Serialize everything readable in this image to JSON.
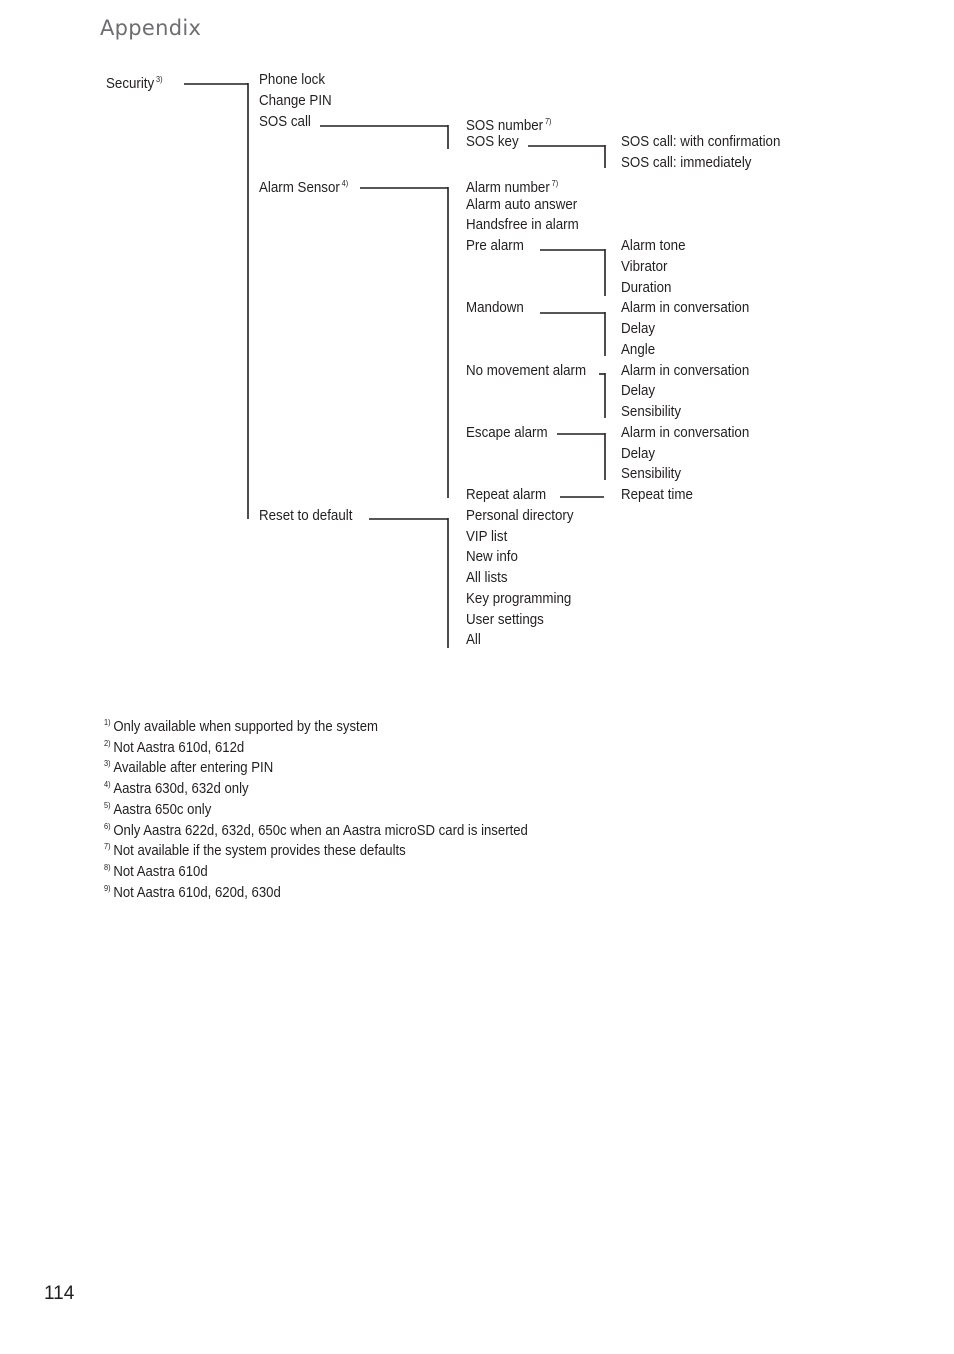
{
  "header": {
    "title": "Appendix"
  },
  "menu_tree": {
    "root": {
      "label": "Security",
      "note": "3)"
    },
    "level1": [
      {
        "label": "Phone lock"
      },
      {
        "label": "Change PIN"
      },
      {
        "label": "SOS call"
      },
      {
        "label": "Alarm Sensor",
        "note": "4)"
      },
      {
        "label": "Reset to default"
      }
    ],
    "sos_call_items": [
      {
        "label": "SOS number",
        "note": "7)"
      },
      {
        "label": "SOS key"
      }
    ],
    "sos_key_items": [
      {
        "label": "SOS call: with confirmation"
      },
      {
        "label": "SOS call: immediately"
      }
    ],
    "alarm_sensor_items": [
      {
        "label": "Alarm number",
        "note": "7)"
      },
      {
        "label": "Alarm auto answer"
      },
      {
        "label": "Handsfree in alarm"
      },
      {
        "label": "Pre alarm"
      },
      {
        "label": "Mandown"
      },
      {
        "label": "No movement alarm"
      },
      {
        "label": "Escape alarm"
      },
      {
        "label": "Repeat alarm"
      }
    ],
    "pre_alarm_items": [
      {
        "label": "Alarm tone"
      },
      {
        "label": "Vibrator"
      },
      {
        "label": "Duration"
      }
    ],
    "mandown_items": [
      {
        "label": "Alarm in conversation"
      },
      {
        "label": "Delay"
      },
      {
        "label": "Angle"
      }
    ],
    "no_movement_items": [
      {
        "label": "Alarm in conversation"
      },
      {
        "label": "Delay"
      },
      {
        "label": "Sensibility"
      }
    ],
    "escape_items": [
      {
        "label": "Alarm in conversation"
      },
      {
        "label": "Delay"
      },
      {
        "label": "Sensibility"
      }
    ],
    "repeat_items": [
      {
        "label": "Repeat time"
      }
    ],
    "reset_items": [
      {
        "label": "Personal directory"
      },
      {
        "label": "VIP list"
      },
      {
        "label": "New info"
      },
      {
        "label": "All lists"
      },
      {
        "label": "Key programming"
      },
      {
        "label": "User settings"
      },
      {
        "label": "All"
      }
    ]
  },
  "footnotes": [
    {
      "mark": "1)",
      "text": "Only available when supported by the system"
    },
    {
      "mark": "2)",
      "text": "Not Aastra 610d, 612d"
    },
    {
      "mark": "3)",
      "text": "Available after entering PIN"
    },
    {
      "mark": "4)",
      "text": "Aastra 630d, 632d only"
    },
    {
      "mark": "5)",
      "text": "Aastra 650c only"
    },
    {
      "mark": "6)",
      "text": "Only Aastra 622d, 632d, 650c when an Aastra microSD card is inserted"
    },
    {
      "mark": "7)",
      "text": "Not available if the system provides these defaults"
    },
    {
      "mark": "8)",
      "text": "Not Aastra 610d"
    },
    {
      "mark": "9)",
      "text": "Not Aastra 610d, 620d, 630d"
    }
  ],
  "footer": {
    "page_number": "114"
  }
}
